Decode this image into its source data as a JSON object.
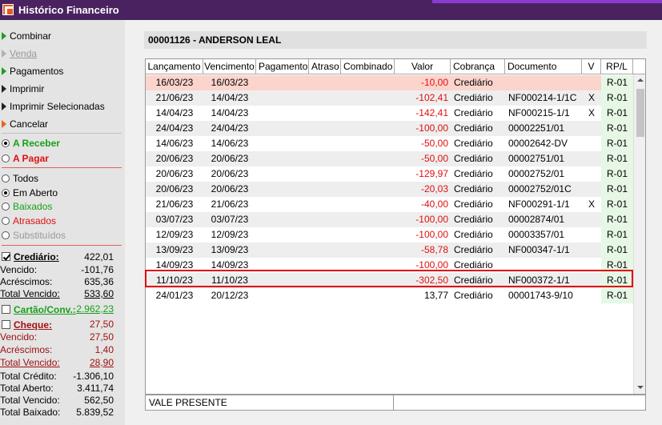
{
  "window": {
    "title": "Histórico Financeiro"
  },
  "menu": {
    "combinar": "Combinar",
    "venda": "Venda",
    "pagamentos": "Pagamentos",
    "imprimir": "Imprimir",
    "imprimir_selecionados": "Imprimir Selecionadas",
    "cancelar": "Cancelar"
  },
  "type": {
    "receber": "A Receber",
    "pagar": "A Pagar"
  },
  "filter": {
    "todos": "Todos",
    "em_aberto": "Em Aberto",
    "baixados": "Baixados",
    "atrasados": "Atrasados",
    "substituidos": "Substituídos"
  },
  "summary": {
    "crediario": {
      "label": "Crediário:",
      "value": "422,01",
      "vencido_label": "Vencido:",
      "vencido": "-101,76",
      "acrescimos_label": "Acréscimos:",
      "acrescimos": "635,36",
      "total_vencido_label": "Total Vencido:",
      "total_vencido": "533,60"
    },
    "cartao": {
      "label": "Cartão/Conv.:",
      "value": "2.962,23"
    },
    "cheque": {
      "label": "Cheque:",
      "value": "27,50",
      "vencido_label": "Vencido:",
      "vencido": "27,50",
      "acrescimos_label": "Acréscimos:",
      "acrescimos": "1,40",
      "total_vencido_label": "Total Vencido:",
      "total_vencido": "28,90"
    },
    "totals": {
      "credito_label": "Total Crédito:",
      "credito": "-1.306,10",
      "aberto_label": "Total Aberto:",
      "aberto": "3.411,74",
      "vencido_label": "Total Vencido:",
      "vencido": "562,50",
      "baixado_label": "Total Baixado:",
      "baixado": "5.839,52"
    }
  },
  "customer": {
    "header": "00001126 - ANDERSON LEAL"
  },
  "table": {
    "columns": [
      "Lançamento",
      "Vencimento",
      "Pagamento",
      "Atraso",
      "Combinado",
      "Valor",
      "Cobrança",
      "Documento",
      "V",
      "RP/L"
    ],
    "rows": [
      {
        "lancamento": "16/03/23",
        "vencimento": "16/03/23",
        "valor": "-10,00",
        "cobranca": "Crediário",
        "documento": "",
        "v": "",
        "rpl": "R-01"
      },
      {
        "lancamento": "21/06/23",
        "vencimento": "14/04/23",
        "valor": "-102,41",
        "cobranca": "Crediário",
        "documento": "NF000214-1/1C",
        "v": "X",
        "rpl": "R-01"
      },
      {
        "lancamento": "14/04/23",
        "vencimento": "14/04/23",
        "valor": "-142,41",
        "cobranca": "Crediário",
        "documento": "NF000215-1/1",
        "v": "X",
        "rpl": "R-01"
      },
      {
        "lancamento": "24/04/23",
        "vencimento": "24/04/23",
        "valor": "-100,00",
        "cobranca": "Crediário",
        "documento": "00002251/01",
        "v": "",
        "rpl": "R-01"
      },
      {
        "lancamento": "14/06/23",
        "vencimento": "14/06/23",
        "valor": "-50,00",
        "cobranca": "Crediário",
        "documento": "00002642-DV",
        "v": "",
        "rpl": "R-01"
      },
      {
        "lancamento": "20/06/23",
        "vencimento": "20/06/23",
        "valor": "-50,00",
        "cobranca": "Crediário",
        "documento": "00002751/01",
        "v": "",
        "rpl": "R-01"
      },
      {
        "lancamento": "20/06/23",
        "vencimento": "20/06/23",
        "valor": "-129,97",
        "cobranca": "Crediário",
        "documento": "00002752/01",
        "v": "",
        "rpl": "R-01"
      },
      {
        "lancamento": "20/06/23",
        "vencimento": "20/06/23",
        "valor": "-20,03",
        "cobranca": "Crediário",
        "documento": "00002752/01C",
        "v": "",
        "rpl": "R-01"
      },
      {
        "lancamento": "21/06/23",
        "vencimento": "21/06/23",
        "valor": "-40,00",
        "cobranca": "Crediário",
        "documento": "NF000291-1/1",
        "v": "X",
        "rpl": "R-01"
      },
      {
        "lancamento": "03/07/23",
        "vencimento": "03/07/23",
        "valor": "-100,00",
        "cobranca": "Crediário",
        "documento": "00002874/01",
        "v": "",
        "rpl": "R-01"
      },
      {
        "lancamento": "12/09/23",
        "vencimento": "12/09/23",
        "valor": "-100,00",
        "cobranca": "Crediário",
        "documento": "00003357/01",
        "v": "",
        "rpl": "R-01"
      },
      {
        "lancamento": "13/09/23",
        "vencimento": "13/09/23",
        "valor": "-58,78",
        "cobranca": "Crediário",
        "documento": "NF000347-1/1",
        "v": "",
        "rpl": "R-01"
      },
      {
        "lancamento": "14/09/23",
        "vencimento": "14/09/23",
        "valor": "-100,00",
        "cobranca": "Crediário",
        "documento": "",
        "v": "",
        "rpl": "R-01"
      },
      {
        "lancamento": "11/10/23",
        "vencimento": "11/10/23",
        "valor": "-302,50",
        "cobranca": "Crediário",
        "documento": "NF000372-1/1",
        "v": "",
        "rpl": "R-01"
      },
      {
        "lancamento": "24/01/23",
        "vencimento": "20/12/23",
        "valor": "13,77",
        "cobranca": "Crediário",
        "documento": "00001743-9/10",
        "v": "",
        "rpl": "R-01"
      }
    ]
  },
  "footer": {
    "label": "VALE PRESENTE"
  },
  "colors": {
    "titlebar": "#4a2260",
    "negative": "#e01010",
    "highlight": "#e00000",
    "first_row": "#fbd4cc"
  }
}
